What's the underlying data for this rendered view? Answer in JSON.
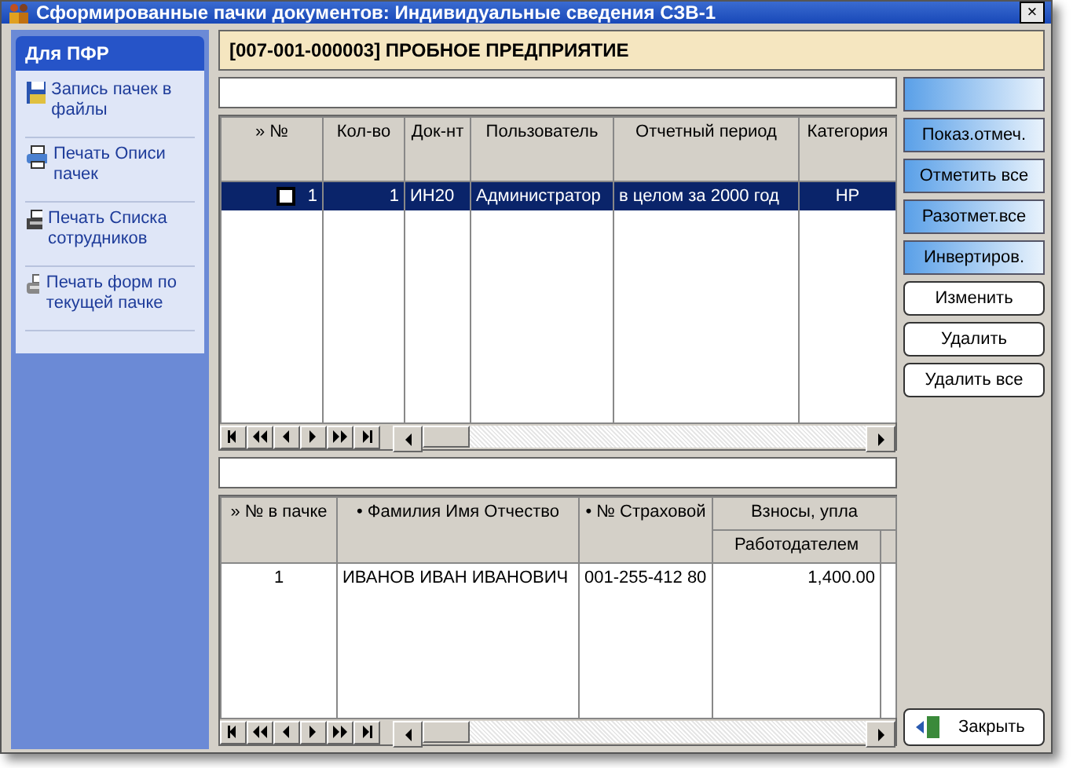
{
  "window": {
    "title": "Сформированные пачки документов: Индивидуальные сведения СЗВ-1",
    "close": "×"
  },
  "sidebar": {
    "title": "Для ПФР",
    "items": [
      {
        "kind": "floppy",
        "label": "Запись пачек в файлы"
      },
      {
        "kind": "printer",
        "label": "Печать Описи пачек"
      },
      {
        "kind": "printer2",
        "label": "Печать Списка сотрудников"
      },
      {
        "kind": "printer3",
        "label": "Печать форм по текущей пачке"
      }
    ]
  },
  "header": "[007-001-000003] ПРОБНОЕ ПРЕДПРИЯТИЕ",
  "top_table": {
    "columns": [
      "» №",
      "Кол-во",
      "Док-нт",
      "Пользователь",
      "Отчетный период",
      "Категория"
    ],
    "rows": [
      {
        "selected": true,
        "checked": false,
        "cells": [
          "1",
          "1",
          "ИН20",
          "Администратор",
          "в целом за 2000 год",
          "НР"
        ]
      }
    ]
  },
  "bottom_table": {
    "columns": [
      "» № в пачке",
      "• Фамилия Имя Отчество",
      "• № Страховой"
    ],
    "group": "Взносы, упла",
    "subcolumns": [
      "Работодателем"
    ],
    "rows": [
      {
        "cells": [
          "1",
          "ИВАНОВ ИВАН ИВАНОВИЧ",
          "001-255-412 80",
          "1,400.00"
        ]
      }
    ]
  },
  "buttons": [
    {
      "kind": "blue"
    },
    {
      "kind": "blue",
      "label": "Показ.отмеч."
    },
    {
      "kind": "blue",
      "label": "Отметить все"
    },
    {
      "kind": "blue",
      "label": "Разотмет.все"
    },
    {
      "kind": "blue",
      "label": "Инвертиров."
    },
    {
      "kind": "plain",
      "label": "Изменить"
    },
    {
      "kind": "plain",
      "label": "Удалить"
    },
    {
      "kind": "plain",
      "label": "Удалить все"
    }
  ],
  "close_button": "Закрыть"
}
